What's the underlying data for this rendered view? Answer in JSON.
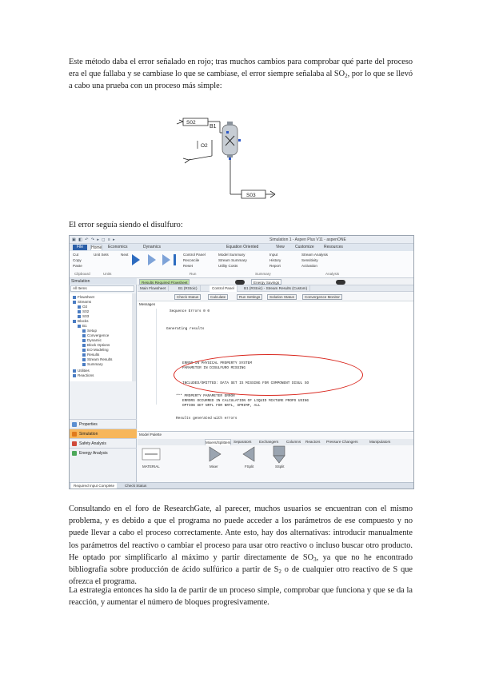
{
  "paragraph1": {
    "text": "Este método daba el error señalado en rojo; tras muchos cambios para comprobar qué parte del proceso era el que fallaba y se cambiase lo que se cambiase, el error siempre señalaba al SO",
    "sub": "2",
    "tail": ", por lo que se llevó a cabo una prueba con un proceso más simple:"
  },
  "flowsheet": {
    "stream_in": "S02",
    "block": "B1",
    "stream_left": "O2",
    "stream_out": "S03"
  },
  "caption2": "El error seguía siendo el disulfuro:",
  "screenshot": {
    "window_title": "Simulation 1 - Aspen Plus V11 - aspenONE",
    "menu": {
      "file": "File",
      "tabs": [
        "Home",
        "Economics",
        "Dynamics",
        "Equation Oriented",
        "View",
        "Customize",
        "Resources"
      ]
    },
    "ribbon": {
      "clipboard": [
        "Cut",
        "Copy",
        "Paste"
      ],
      "units": [
        "Unit Sets",
        "Next"
      ],
      "run_items": [
        "Control Panel",
        "Reconcile",
        "Reset"
      ],
      "summary_items": [
        "Model Summary",
        "Stream Summary",
        "Utility Costs"
      ],
      "analysis_items": [
        "Input",
        "History",
        "Report"
      ],
      "other_items": [
        "Stream Analysis",
        "Sensitivity",
        "Activation"
      ],
      "groups": [
        "Clipboard",
        "Units",
        "Run",
        "Summary",
        "Analysis"
      ]
    },
    "sidebar": {
      "title": "Simulation",
      "search": "All Items",
      "tree": [
        "Flowsheet",
        "Streams",
        "O2",
        "S02",
        "S03",
        "Blocks",
        "B1",
        "Setup",
        "Convergence",
        "Dynamic",
        "Block Options",
        "EO Modeling",
        "Results",
        "Stream Results",
        "Summary",
        "Utilities",
        "Reactions"
      ],
      "nav": [
        "Properties",
        "Simulation",
        "Safety Analysis",
        "Energy Analysis"
      ]
    },
    "main": {
      "toolbar_left": "Results Required Flowsheet",
      "toolbar_right": "Energy Savings",
      "tabs": [
        "Main Flowsheet",
        "B1 (RStoic)",
        "Control Panel",
        "B1 (RStoic) - Stream Results (Custom)"
      ],
      "run_buttons": [
        "Check Status",
        "Calculate",
        "Run Settings",
        "Solution Status",
        "Convergence Monitor"
      ],
      "sections": [
        "Messages",
        "Sections"
      ],
      "messages": [
        "Sequence        Errors      0      0",
        "Generating results",
        "ERROR  IN  PHYSICAL  PROPERTY  SYSTEM",
        "PARAMETER  IN  DISULFURO  MISSING",
        "INCLUDED/OMITTED: DATA SET IS MISSING FOR COMPONENT DISUL SO",
        "*** PROPERTY PARAMETER ERROR",
        "ERRORS OCCURRED IN CALCULATION OF LIQUID MIXTURE PROPS USING",
        "OPTION SET NRTL FOR NRTL, SPRIMP, ALL",
        "Results generated with errors"
      ],
      "status": "All Sections"
    },
    "palette": {
      "title": "Model Palette",
      "tabs": [
        "Mixers/Splitters",
        "Separators",
        "Exchangers",
        "Columns",
        "Reactors",
        "Pressure Changers",
        "Manipulators"
      ],
      "blocks": [
        "MATERIAL",
        "Mixer",
        "FSplit",
        "SSplit"
      ]
    },
    "footer_tabs": [
      "Required Input Complete",
      "Check Status"
    ]
  },
  "paragraph3": {
    "a": "Consultando en el foro de ResearchGate, al parecer, muchos usuarios se encuentran con el mismo problema, y es debido a que el programa no puede acceder a los parámetros de ese compuesto y no puede llevar a cabo el proceso correctamente. Ante esto, hay dos alternativas: introducir manualmente los parámetros del reactivo o cambiar el proceso para usar otro reactivo o incluso buscar otro producto. He optado por simplificarlo al máximo y partir directamente de SO",
    "sub1": "3",
    "b": ", ya que no he encontrado bibliografía sobre producción de ácido sulfúrico a partir de S",
    "sub2": "2",
    "c": " o de cualquier otro reactivo de S que ofrezca el programa."
  },
  "paragraph4": "La estrategia entonces ha sido la de partir de un proceso simple, comprobar que funciona y que se da la reacción, y aumentar el número de bloques progresivamente.",
  "colors": {
    "error_ellipse": "#d9251c",
    "aspen_blue": "#2b5fa8",
    "active_nav": "#f7b65a"
  }
}
